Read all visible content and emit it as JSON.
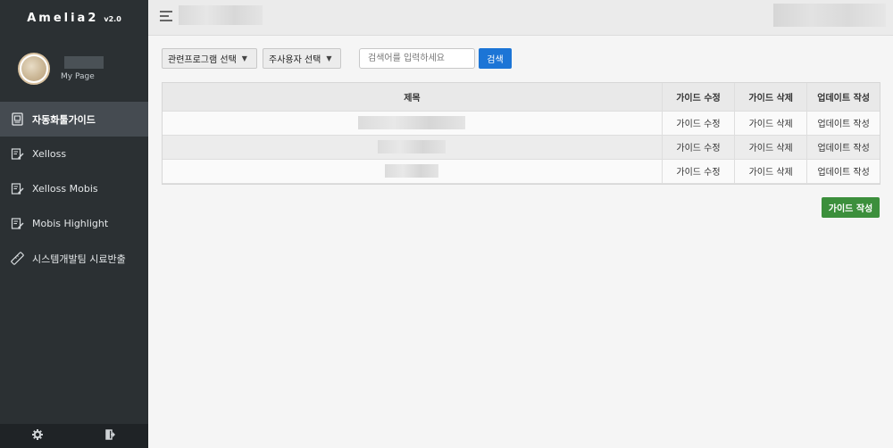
{
  "app": {
    "name": "Amelia2",
    "version": "v2.0"
  },
  "profile": {
    "subtitle": "My Page"
  },
  "sidebar": {
    "items": [
      {
        "label": "자동화툴가이드",
        "icon": "book-icon",
        "active": true
      },
      {
        "label": "Xelloss",
        "icon": "edit-doc-icon",
        "active": false
      },
      {
        "label": "Xelloss Mobis",
        "icon": "edit-doc-icon",
        "active": false
      },
      {
        "label": "Mobis Highlight",
        "icon": "edit-doc-icon",
        "active": false
      },
      {
        "label": "시스템개발팀 시료반출",
        "icon": "ruler-icon",
        "active": false
      }
    ],
    "footer": {
      "settings_icon": "gear-icon",
      "logout_icon": "logout-icon"
    }
  },
  "topbar": {
    "menu_icon": "menu-toggle-icon"
  },
  "filters": {
    "program_select": "관련프로그램 선택",
    "user_select": "주사용자 선택",
    "search_placeholder": "검색어를 입력하세요",
    "search_button": "검색"
  },
  "table": {
    "headers": [
      "제목",
      "가이드 수정",
      "가이드 삭제",
      "업데이트 작성"
    ],
    "rows": [
      {
        "edit": "가이드 수정",
        "delete": "가이드 삭제",
        "update": "업데이트 작성"
      },
      {
        "edit": "가이드 수정",
        "delete": "가이드 삭제",
        "update": "업데이트 작성"
      },
      {
        "edit": "가이드 수정",
        "delete": "가이드 삭제",
        "update": "업데이트 작성"
      }
    ]
  },
  "create_button": "가이드 작성",
  "colors": {
    "sidebar": "#2b3033",
    "active_item": "#454b51",
    "primary": "#1c75d6",
    "success": "#3c8f3c"
  }
}
